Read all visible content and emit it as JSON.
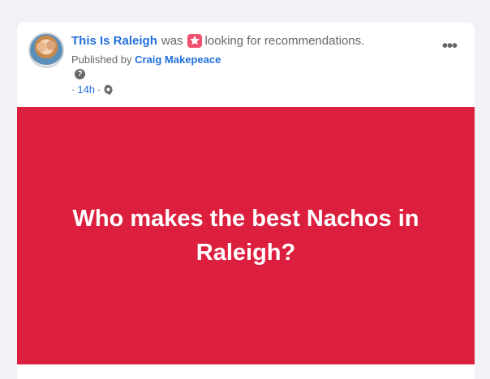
{
  "post": {
    "page_name": "This Is Raleigh",
    "was_text": "was",
    "activity": "looking for recommendations.",
    "published_by_prefix": "Published by",
    "publisher": "Craig Makepeace",
    "help_icon": "?",
    "time_prefix": "·",
    "time": "14h",
    "time_suffix": "·",
    "more_icon": "•••",
    "banner_text": "Who makes the best Nachos in Raleigh?",
    "banner_color": "#dc1f3e",
    "link_color": "#216fdb"
  }
}
